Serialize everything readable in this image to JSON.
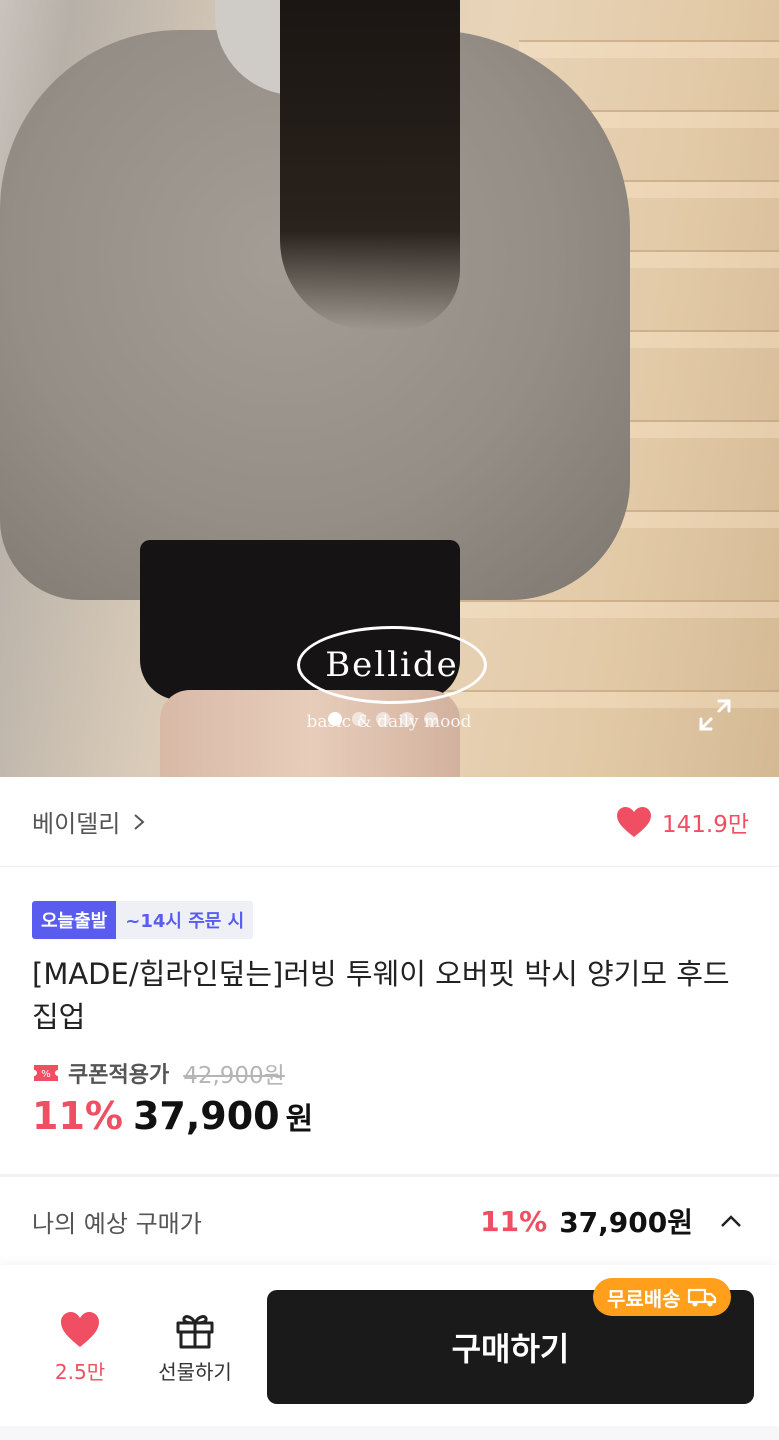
{
  "hero": {
    "brand_logo": "Bellide",
    "brand_tagline": "basic & daily mood",
    "carousel_dots": 5,
    "carousel_active_index": 0,
    "expand_icon": "expand-icon"
  },
  "seller": {
    "name": "베이델리",
    "chevron_icon": "chevron-right-icon",
    "like_icon": "heart-icon",
    "like_count": "141.9만"
  },
  "product": {
    "badge_today": "오늘출발",
    "badge_cutoff": "~14시 주문 시",
    "title": "[MADE/힙라인덮는]러빙 투웨이 오버핏 박시 양기모 후드집업",
    "coupon_label": "쿠폰적용가",
    "original_price": "42,900원",
    "discount": "11%",
    "sale_price": "37,900",
    "currency": "원"
  },
  "estimate": {
    "label": "나의 예상 구매가",
    "discount": "11%",
    "price": "37,900원"
  },
  "bottom_bar": {
    "like_count": "2.5만",
    "gift_label": "선물하기",
    "buy_label": "구매하기",
    "free_shipping_label": "무료배송"
  },
  "colors": {
    "accent_red": "#f04f63",
    "badge_blue": "#5a5cf0",
    "buy_button": "#1a1a1a",
    "free_shipping": "#ff9f1c"
  }
}
